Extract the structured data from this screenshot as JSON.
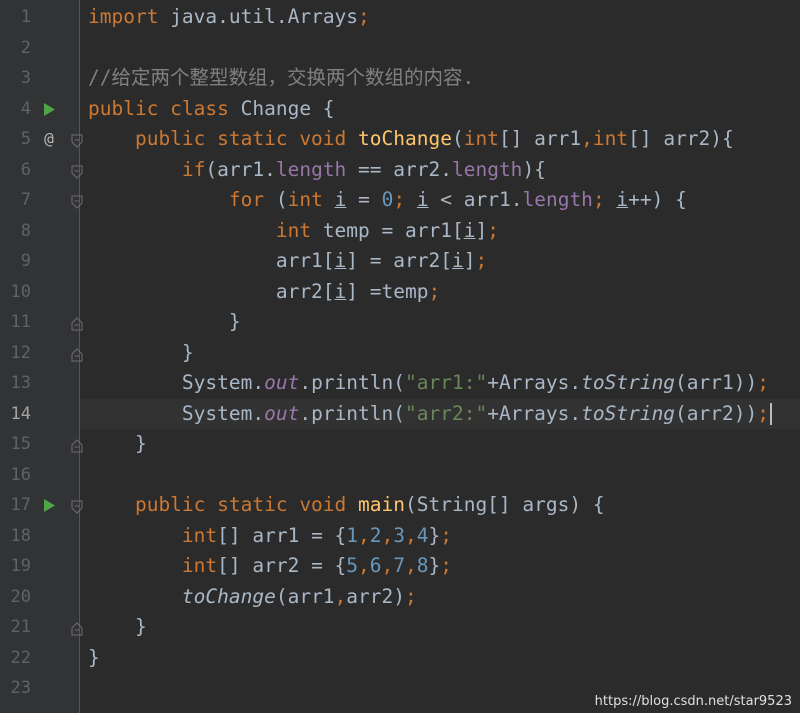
{
  "editor": {
    "current_line": 14,
    "lines": [
      {
        "num": "1",
        "segments": [
          {
            "t": "import",
            "c": "kw"
          },
          {
            "t": " java.util.Arrays",
            "c": ""
          },
          {
            "t": ";",
            "c": "kw"
          }
        ]
      },
      {
        "num": "2",
        "segments": []
      },
      {
        "num": "3",
        "segments": [
          {
            "t": "//给定两个整型数组，交换两个数组的内容.",
            "c": "cmt"
          }
        ]
      },
      {
        "num": "4",
        "marker": "run",
        "segments": [
          {
            "t": "public class",
            "c": "kw"
          },
          {
            "t": " Change {",
            "c": ""
          }
        ]
      },
      {
        "num": "5",
        "marker": "override",
        "fold": "open",
        "segments": [
          {
            "t": "    public static void ",
            "c": "kw"
          },
          {
            "t": "toChange",
            "c": "fn"
          },
          {
            "t": "(",
            "c": ""
          },
          {
            "t": "int",
            "c": "kw"
          },
          {
            "t": "[] arr1",
            "c": ""
          },
          {
            "t": ",",
            "c": "kw"
          },
          {
            "t": "int",
            "c": "kw"
          },
          {
            "t": "[] arr2){",
            "c": ""
          }
        ]
      },
      {
        "num": "6",
        "fold": "open",
        "segments": [
          {
            "t": "        ",
            "c": ""
          },
          {
            "t": "if",
            "c": "kw"
          },
          {
            "t": "(arr1.",
            "c": ""
          },
          {
            "t": "length",
            "c": "field"
          },
          {
            "t": " == arr2.",
            "c": ""
          },
          {
            "t": "length",
            "c": "field"
          },
          {
            "t": "){",
            "c": ""
          }
        ]
      },
      {
        "num": "7",
        "fold": "open",
        "segments": [
          {
            "t": "            ",
            "c": ""
          },
          {
            "t": "for",
            "c": "kw"
          },
          {
            "t": " (",
            "c": ""
          },
          {
            "t": "int",
            "c": "kw"
          },
          {
            "t": " ",
            "c": ""
          },
          {
            "t": "i",
            "c": "ul"
          },
          {
            "t": " = ",
            "c": ""
          },
          {
            "t": "0",
            "c": "num"
          },
          {
            "t": "; ",
            "c": "kw"
          },
          {
            "t": "i",
            "c": "ul"
          },
          {
            "t": " < arr1.",
            "c": ""
          },
          {
            "t": "length",
            "c": "field"
          },
          {
            "t": "; ",
            "c": "kw"
          },
          {
            "t": "i",
            "c": "ul"
          },
          {
            "t": "++) {",
            "c": ""
          }
        ]
      },
      {
        "num": "8",
        "segments": [
          {
            "t": "                ",
            "c": ""
          },
          {
            "t": "int",
            "c": "kw"
          },
          {
            "t": " temp = arr1[",
            "c": ""
          },
          {
            "t": "i",
            "c": "ul"
          },
          {
            "t": "]",
            "c": ""
          },
          {
            "t": ";",
            "c": "kw"
          }
        ]
      },
      {
        "num": "9",
        "segments": [
          {
            "t": "                arr1[",
            "c": ""
          },
          {
            "t": "i",
            "c": "ul"
          },
          {
            "t": "] = arr2[",
            "c": ""
          },
          {
            "t": "i",
            "c": "ul"
          },
          {
            "t": "]",
            "c": ""
          },
          {
            "t": ";",
            "c": "kw"
          }
        ]
      },
      {
        "num": "10",
        "segments": [
          {
            "t": "                arr2[",
            "c": ""
          },
          {
            "t": "i",
            "c": "ul"
          },
          {
            "t": "] =temp",
            "c": ""
          },
          {
            "t": ";",
            "c": "kw"
          }
        ]
      },
      {
        "num": "11",
        "fold": "close",
        "segments": [
          {
            "t": "            }",
            "c": ""
          }
        ]
      },
      {
        "num": "12",
        "fold": "close",
        "segments": [
          {
            "t": "        }",
            "c": ""
          }
        ]
      },
      {
        "num": "13",
        "segments": [
          {
            "t": "        System.",
            "c": ""
          },
          {
            "t": "out",
            "c": "static-field"
          },
          {
            "t": ".println(",
            "c": ""
          },
          {
            "t": "\"arr1:\"",
            "c": "str"
          },
          {
            "t": "+Arrays.",
            "c": ""
          },
          {
            "t": "toString",
            "c": "it"
          },
          {
            "t": "(arr1))",
            "c": ""
          },
          {
            "t": ";",
            "c": "kw"
          }
        ]
      },
      {
        "num": "14",
        "caret": true,
        "segments": [
          {
            "t": "        System.",
            "c": ""
          },
          {
            "t": "out",
            "c": "static-field"
          },
          {
            "t": ".println(",
            "c": ""
          },
          {
            "t": "\"arr2:\"",
            "c": "str"
          },
          {
            "t": "+Arrays.",
            "c": ""
          },
          {
            "t": "toString",
            "c": "it"
          },
          {
            "t": "(arr2))",
            "c": ""
          },
          {
            "t": ";",
            "c": "kw"
          }
        ]
      },
      {
        "num": "15",
        "fold": "close",
        "segments": [
          {
            "t": "    }",
            "c": ""
          }
        ]
      },
      {
        "num": "16",
        "segments": []
      },
      {
        "num": "17",
        "marker": "run",
        "fold": "open",
        "segments": [
          {
            "t": "    public static void ",
            "c": "kw"
          },
          {
            "t": "main",
            "c": "fn"
          },
          {
            "t": "(String[] args) {",
            "c": ""
          }
        ]
      },
      {
        "num": "18",
        "segments": [
          {
            "t": "        ",
            "c": ""
          },
          {
            "t": "int",
            "c": "kw"
          },
          {
            "t": "[] arr1 = {",
            "c": ""
          },
          {
            "t": "1",
            "c": "num"
          },
          {
            "t": ",",
            "c": "kw"
          },
          {
            "t": "2",
            "c": "num"
          },
          {
            "t": ",",
            "c": "kw"
          },
          {
            "t": "3",
            "c": "num"
          },
          {
            "t": ",",
            "c": "kw"
          },
          {
            "t": "4",
            "c": "num"
          },
          {
            "t": "}",
            "c": ""
          },
          {
            "t": ";",
            "c": "kw"
          }
        ]
      },
      {
        "num": "19",
        "segments": [
          {
            "t": "        ",
            "c": ""
          },
          {
            "t": "int",
            "c": "kw"
          },
          {
            "t": "[] arr2 = {",
            "c": ""
          },
          {
            "t": "5",
            "c": "num"
          },
          {
            "t": ",",
            "c": "kw"
          },
          {
            "t": "6",
            "c": "num"
          },
          {
            "t": ",",
            "c": "kw"
          },
          {
            "t": "7",
            "c": "num"
          },
          {
            "t": ",",
            "c": "kw"
          },
          {
            "t": "8",
            "c": "num"
          },
          {
            "t": "}",
            "c": ""
          },
          {
            "t": ";",
            "c": "kw"
          }
        ]
      },
      {
        "num": "20",
        "segments": [
          {
            "t": "        ",
            "c": ""
          },
          {
            "t": "toChange",
            "c": "it"
          },
          {
            "t": "(arr1",
            "c": ""
          },
          {
            "t": ",",
            "c": "kw"
          },
          {
            "t": "arr2)",
            "c": ""
          },
          {
            "t": ";",
            "c": "kw"
          }
        ]
      },
      {
        "num": "21",
        "fold": "close",
        "segments": [
          {
            "t": "    }",
            "c": ""
          }
        ]
      },
      {
        "num": "22",
        "segments": [
          {
            "t": "}",
            "c": ""
          }
        ]
      },
      {
        "num": "23",
        "segments": []
      }
    ],
    "override_glyph": "@"
  },
  "watermark": "https://blog.csdn.net/star9523",
  "colors": {
    "background": "#2b2b2b",
    "gutter": "#313335",
    "keyword": "#cc7832",
    "function": "#ffc66d",
    "field": "#9876aa",
    "number": "#6897bb",
    "string": "#6a8759",
    "comment": "#808080",
    "text": "#a9b7c6"
  }
}
